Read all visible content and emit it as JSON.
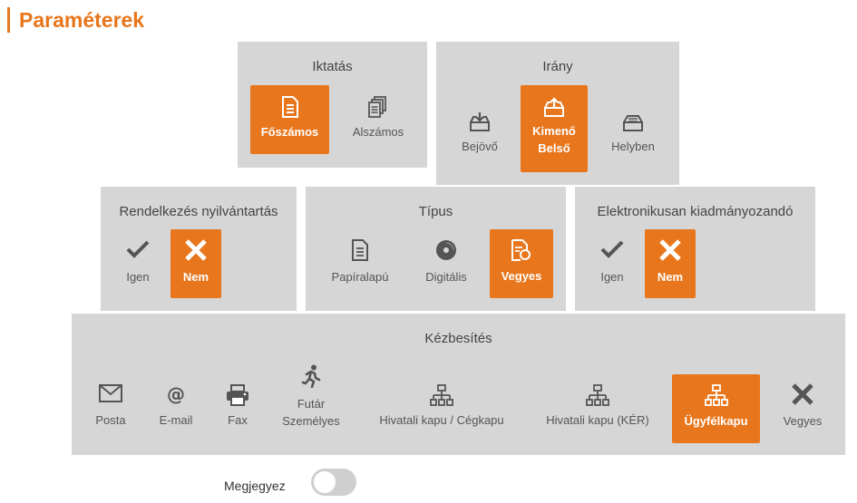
{
  "page_title": "Paraméterek",
  "iktatas": {
    "title": "Iktatás",
    "options": [
      "Főszámos",
      "Alszámos"
    ],
    "selected": "Főszámos"
  },
  "irany": {
    "title": "Irány",
    "options": [
      "Bejövő",
      "Kimenő\nBelső",
      "Helyben"
    ],
    "selected": "Kimenő Belső",
    "kimeno_line1": "Kimenő",
    "kimeno_line2": "Belső"
  },
  "rendelkezes": {
    "title": "Rendelkezés nyilvántartás",
    "options": [
      "Igen",
      "Nem"
    ],
    "selected": "Nem"
  },
  "tipus": {
    "title": "Típus",
    "options": [
      "Papíralapú",
      "Digitális",
      "Vegyes"
    ],
    "selected": "Vegyes"
  },
  "elektronikus": {
    "title": "Elektronikusan kiadmányozandó",
    "options": [
      "Igen",
      "Nem"
    ],
    "selected": "Nem"
  },
  "kezbesites": {
    "title": "Kézbesítés",
    "options": [
      "Posta",
      "E-mail",
      "Fax",
      "Futár",
      "Személyes",
      "Hivatali kapu / Cégkapu",
      "Hivatali kapu (KÉR)",
      "Ügyfélkapu",
      "Vegyes"
    ],
    "selected": "Ügyfélkapu"
  },
  "megjegyez": {
    "label": "Megjegyez",
    "checked": false
  },
  "colors": {
    "accent": "#e8761c",
    "panel_bg": "#d6d6d6"
  }
}
